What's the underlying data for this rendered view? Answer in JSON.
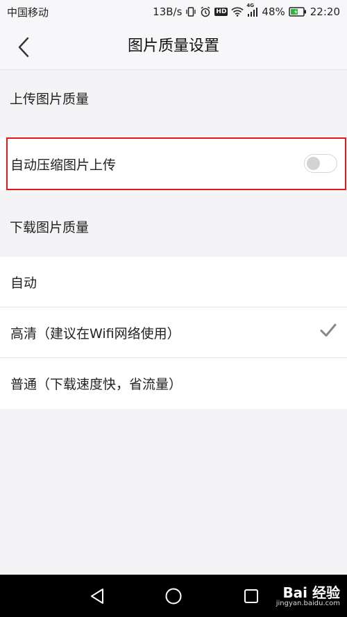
{
  "status_bar": {
    "carrier": "中国移动",
    "speed": "13B/s",
    "network": "4G",
    "battery": "48%",
    "time": "22:20",
    "hd_label": "HD"
  },
  "header": {
    "title": "图片质量设置",
    "back_icon": "chevron-left-icon"
  },
  "upload": {
    "section_title": "上传图片质量",
    "compress_label": "自动压缩图片上传",
    "compress_enabled": false
  },
  "download": {
    "section_title": "下载图片质量",
    "options": [
      {
        "label": "自动",
        "selected": false
      },
      {
        "label": "高清（建议在Wifi网络使用）",
        "selected": true
      },
      {
        "label": "普通（下载速度快，省流量）",
        "selected": false
      }
    ]
  },
  "watermark": {
    "brand": "Bai 经验",
    "url": "jingyan.baidu.com"
  },
  "colors": {
    "highlight": "#e01818",
    "check": "#888888"
  }
}
